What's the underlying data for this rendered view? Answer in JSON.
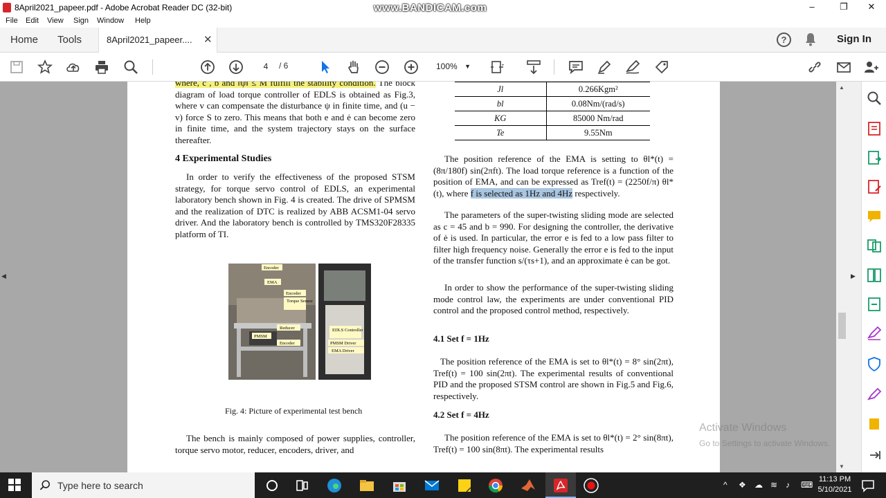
{
  "titlebar": {
    "title": "8April2021_papeer.pdf - Adobe Acrobat Reader DC (32-bit)",
    "watermark": "www.BANDICAM.com",
    "minimize": "–",
    "maximize": "❐",
    "close": "✕"
  },
  "menu": [
    "File",
    "Edit",
    "View",
    "Sign",
    "Window",
    "Help"
  ],
  "tabs": {
    "home": "Home",
    "tools": "Tools",
    "doc": "8April2021_papeer....",
    "doc_close": "✕",
    "signin": "Sign In",
    "help": "?"
  },
  "toolbar": {
    "page_current": "4",
    "page_total": "/   6",
    "zoom": "100%"
  },
  "page": {
    "left": {
      "p1_highlight": "where, c , b and ‖ψ‖ ≤ M fulfill the stability condition.",
      "p1_rest": " The block diagram of load torque controller of EDLS is obtained as Fig.3, where v can compensate the disturbance ψ in finite time, and (u − v) force S to zero. This means that both e and ė can become zero in finite time, and the system trajectory stays on the surface thereafter.",
      "section_heading": "4    Experimental Studies",
      "p2": "In order to verify the effectiveness of the proposed STSM strategy, for torque servo control of EDLS, an experimental laboratory bench shown in Fig. 4 is created. The drive of SPMSM and the realization of DTC is realized by ABB ACSM1-04 servo driver. And the laboratory bench is controlled by TMS320F28335 platform of TI.",
      "fig_labels": [
        "Encoder",
        "EMA",
        "Encoder",
        "Torque Sensor",
        "Reducer",
        "PMSM",
        "Encoder",
        "EDLS Controller",
        "PMSM Driver",
        "EMA Driver"
      ],
      "fig_caption": "Fig. 4: Picture of experimental test bench",
      "p3": "The bench is mainly composed of power supplies, controller, torque servo motor, reducer, encoders, driver, and"
    },
    "table": [
      {
        "sym": "Jl",
        "val": "0.266Kgm²"
      },
      {
        "sym": "bl",
        "val": "0.08Nm/(rad/s)"
      },
      {
        "sym": "KG",
        "val": "85000 Nm/rad"
      },
      {
        "sym": "Te",
        "val": "9.55Nm"
      }
    ],
    "right": {
      "p1a": "The position reference of the EMA is setting to θl*(t) = (8π/180f) sin(2πft). The load torque reference is a function of the position of EMA, and can be expressed as Tref(t) = (2250f/π) θl*(t), where ",
      "p1_sel1": "f",
      "p1_sel2": " is selected as ",
      "p1_sel3": "1Hz",
      "p1_sel4": " and ",
      "p1_sel5": "4Hz",
      "p1b": " respectively.",
      "p2": "The parameters of the super-twisting sliding mode are selected as c = 45 and b = 990. For designing the controller, the derivative of ė is used. In particular, the error e is fed to a low pass filter to filter high frequency noise. Generally the error e is fed to the input of the transfer function s/(τs+1), and an approximate ė can be got.",
      "p3": "In order to show the performance of the super-twisting sliding mode control law, the experiments are under conventional PID control and the proposed control method, respectively.",
      "sub1": "4.1    Set f = 1Hz",
      "p4": "The position reference of the EMA is set to θl*(t) = 8° sin(2πt), Tref(t) = 100 sin(2πt). The experimental results of conventional PID and the proposed STSM control are shown in Fig.5 and Fig.6, respectively.",
      "sub2": "4.2    Set f = 4Hz",
      "p5": "The position reference of the EMA is set to θl*(t) = 2° sin(8πt), Tref(t) = 100 sin(8πt). The experimental results"
    }
  },
  "overlay": {
    "activate": "Activate Windows",
    "activate_sub": "Go to Settings to activate Windows."
  },
  "taskbar": {
    "search_placeholder": "Type here to search",
    "time": "11:13 PM",
    "date": "5/10/2021"
  },
  "colors": {
    "accent_red": "#d7262a",
    "highlight_yellow": "#f4f07a",
    "selection_blue": "#a9c5e0",
    "taskbar": "#1f1f1f"
  }
}
